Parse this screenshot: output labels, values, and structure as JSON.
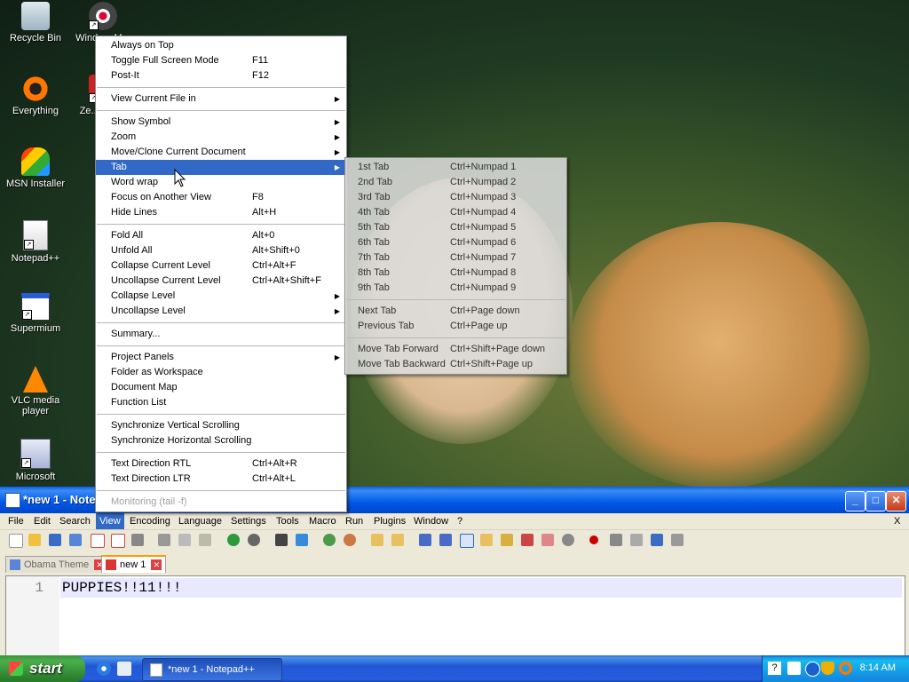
{
  "desktop": {
    "icons": [
      {
        "label": "Recycle Bin"
      },
      {
        "label": "Windo... M..."
      },
      {
        "label": "Everything"
      },
      {
        "label": "Ze... Anti..."
      },
      {
        "label": "MSN Installer"
      },
      {
        "label": "Notepad++"
      },
      {
        "label": "Supermium"
      },
      {
        "label": "VLC media player"
      },
      {
        "label": "Microsoft"
      }
    ]
  },
  "view_menu": {
    "items": [
      {
        "label": "Always on Top",
        "shortcut": ""
      },
      {
        "label": "Toggle Full Screen Mode",
        "shortcut": "F11"
      },
      {
        "label": "Post-It",
        "shortcut": "F12"
      },
      {
        "label": "View Current File in",
        "shortcut": ""
      },
      {
        "label": "Show Symbol",
        "shortcut": ""
      },
      {
        "label": "Zoom",
        "shortcut": ""
      },
      {
        "label": "Move/Clone Current Document",
        "shortcut": ""
      },
      {
        "label": "Tab",
        "shortcut": ""
      },
      {
        "label": "Word wrap",
        "shortcut": ""
      },
      {
        "label": "Focus on Another View",
        "shortcut": "F8"
      },
      {
        "label": "Hide Lines",
        "shortcut": "Alt+H"
      },
      {
        "label": "Fold All",
        "shortcut": "Alt+0"
      },
      {
        "label": "Unfold All",
        "shortcut": "Alt+Shift+0"
      },
      {
        "label": "Collapse Current Level",
        "shortcut": "Ctrl+Alt+F"
      },
      {
        "label": "Uncollapse Current Level",
        "shortcut": "Ctrl+Alt+Shift+F"
      },
      {
        "label": "Collapse Level",
        "shortcut": ""
      },
      {
        "label": "Uncollapse Level",
        "shortcut": ""
      },
      {
        "label": "Summary...",
        "shortcut": ""
      },
      {
        "label": "Project Panels",
        "shortcut": ""
      },
      {
        "label": "Folder as Workspace",
        "shortcut": ""
      },
      {
        "label": "Document Map",
        "shortcut": ""
      },
      {
        "label": "Function List",
        "shortcut": ""
      },
      {
        "label": "Synchronize Vertical Scrolling",
        "shortcut": ""
      },
      {
        "label": "Synchronize Horizontal Scrolling",
        "shortcut": ""
      },
      {
        "label": "Text Direction RTL",
        "shortcut": "Ctrl+Alt+R"
      },
      {
        "label": "Text Direction LTR",
        "shortcut": "Ctrl+Alt+L"
      },
      {
        "label": "Monitoring (tail -f)",
        "shortcut": ""
      }
    ]
  },
  "tab_submenu": {
    "items": [
      {
        "label": "1st Tab",
        "shortcut": "Ctrl+Numpad 1"
      },
      {
        "label": "2nd Tab",
        "shortcut": "Ctrl+Numpad 2"
      },
      {
        "label": "3rd Tab",
        "shortcut": "Ctrl+Numpad 3"
      },
      {
        "label": "4th Tab",
        "shortcut": "Ctrl+Numpad 4"
      },
      {
        "label": "5th Tab",
        "shortcut": "Ctrl+Numpad 5"
      },
      {
        "label": "6th Tab",
        "shortcut": "Ctrl+Numpad 6"
      },
      {
        "label": "7th Tab",
        "shortcut": "Ctrl+Numpad 7"
      },
      {
        "label": "8th Tab",
        "shortcut": "Ctrl+Numpad 8"
      },
      {
        "label": "9th Tab",
        "shortcut": "Ctrl+Numpad 9"
      },
      {
        "label": "Next Tab",
        "shortcut": "Ctrl+Page down"
      },
      {
        "label": "Previous Tab",
        "shortcut": "Ctrl+Page up"
      },
      {
        "label": "Move Tab Forward",
        "shortcut": "Ctrl+Shift+Page down"
      },
      {
        "label": "Move Tab Backward",
        "shortcut": "Ctrl+Shift+Page up"
      }
    ]
  },
  "window": {
    "title": "*new 1 - Note",
    "menubar": [
      "File",
      "Edit",
      "Search",
      "View",
      "Encoding",
      "Language",
      "Settings",
      "Tools",
      "Macro",
      "Run",
      "Plugins",
      "Window",
      "?"
    ],
    "menubar_close": "X",
    "tabs": [
      {
        "label": "Obama Theme"
      },
      {
        "label": "new 1"
      }
    ],
    "editor": {
      "line_number": "1",
      "text": "PUPPIES!!11!!!"
    }
  },
  "taskbar": {
    "start_label": "start",
    "task_button": "*new 1 - Notepad++",
    "clock": "8:14 AM"
  },
  "colors": {
    "menu_highlight": "#3169c6",
    "xp_blue": "#245edb",
    "start_green": "#3c913c"
  }
}
